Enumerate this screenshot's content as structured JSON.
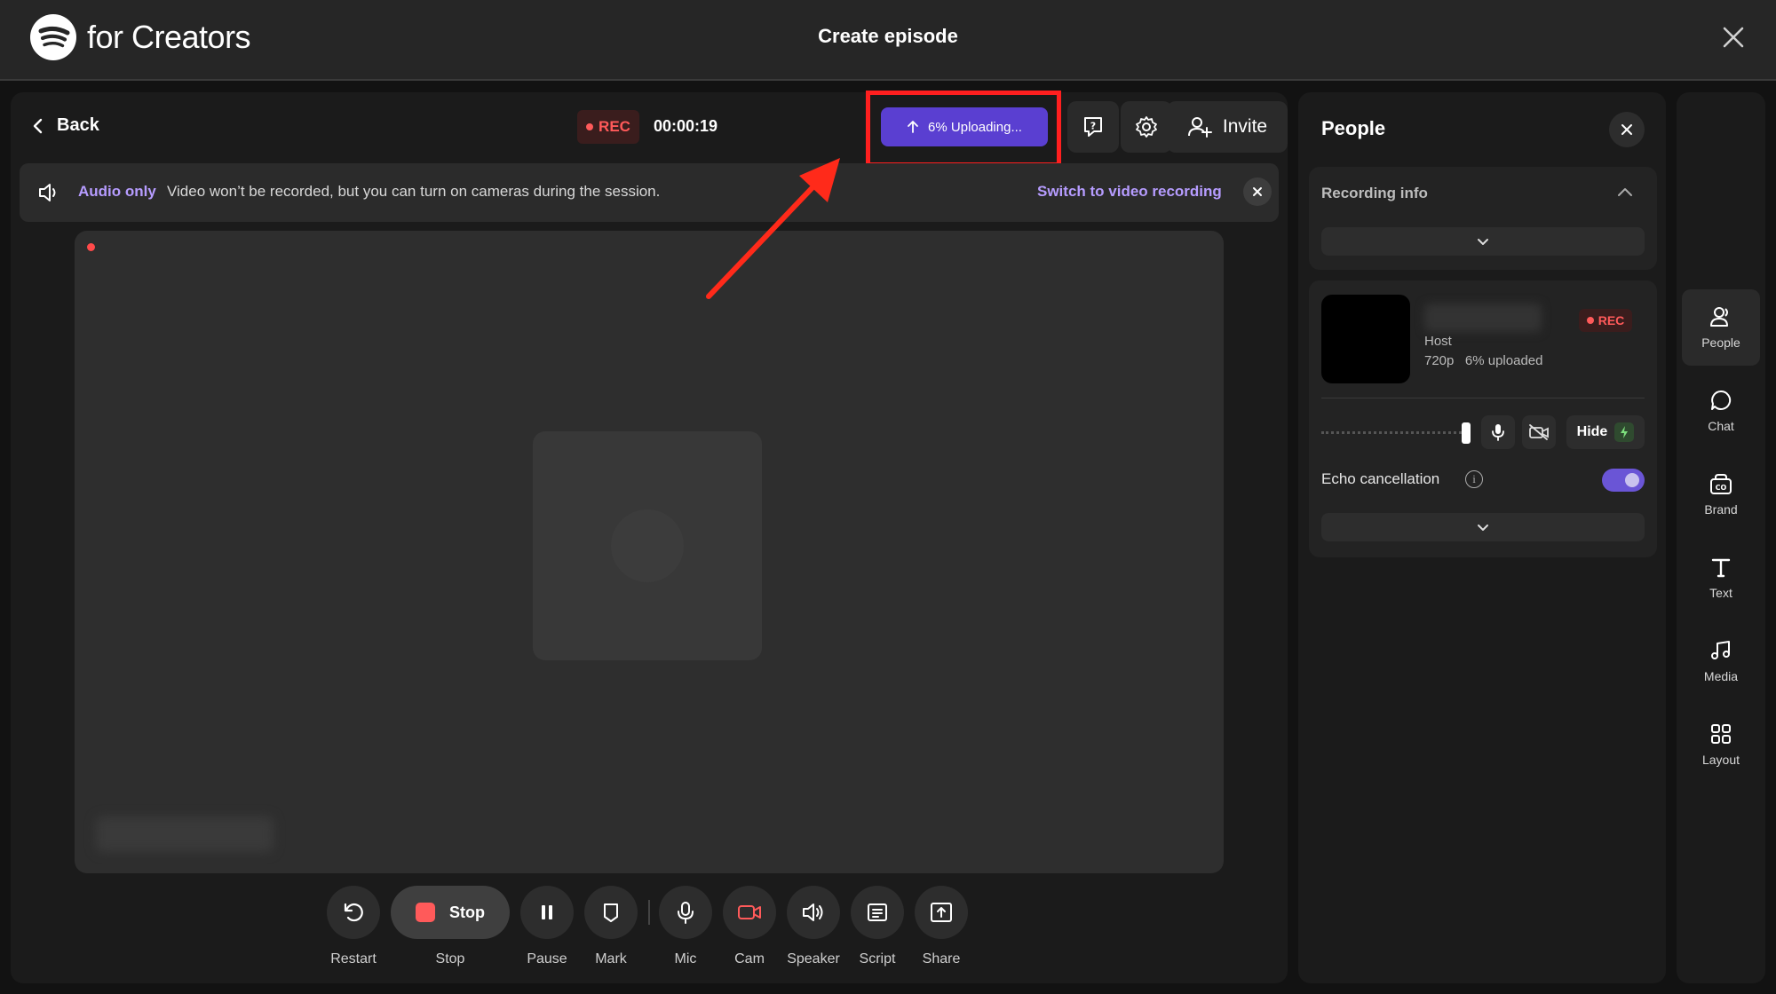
{
  "header": {
    "brand": "for Creators",
    "title": "Create episode"
  },
  "toolbar": {
    "back_label": "Back",
    "rec_label": "REC",
    "timer": "00:00:19",
    "upload_label": "6% Uploading...",
    "invite_label": "Invite"
  },
  "banner": {
    "label": "Audio only",
    "text": "Video won’t be recorded, but you can turn on cameras during the session.",
    "link": "Switch to video recording"
  },
  "controls": [
    {
      "label": "Restart",
      "icon": "restart-icon"
    },
    {
      "label": "Stop",
      "button": "Stop",
      "icon": "stop-icon"
    },
    {
      "label": "Pause",
      "icon": "pause-icon"
    },
    {
      "label": "Mark",
      "icon": "bookmark-icon"
    },
    {
      "label": "Mic",
      "icon": "mic-icon"
    },
    {
      "label": "Cam",
      "icon": "camera-off-icon"
    },
    {
      "label": "Speaker",
      "icon": "speaker-icon"
    },
    {
      "label": "Script",
      "icon": "script-icon"
    },
    {
      "label": "Share",
      "icon": "share-icon"
    }
  ],
  "people_panel": {
    "title": "People",
    "recording_info": "Recording info",
    "participant": {
      "rec": "REC",
      "role": "Host",
      "quality": "720p",
      "upload": "6% uploaded",
      "hide_label": "Hide"
    },
    "echo_label": "Echo cancellation",
    "echo_enabled": true
  },
  "rail": [
    {
      "label": "People",
      "icon": "people-icon",
      "active": true
    },
    {
      "label": "Chat",
      "icon": "chat-icon"
    },
    {
      "label": "Brand",
      "icon": "brand-icon"
    },
    {
      "label": "Text",
      "icon": "text-icon"
    },
    {
      "label": "Media",
      "icon": "music-icon"
    },
    {
      "label": "Layout",
      "icon": "layout-icon"
    }
  ],
  "colors": {
    "accent": "#5a3fd1",
    "rec": "#ff5a5a",
    "highlight": "#ff1f1f",
    "link": "#b69cff"
  }
}
